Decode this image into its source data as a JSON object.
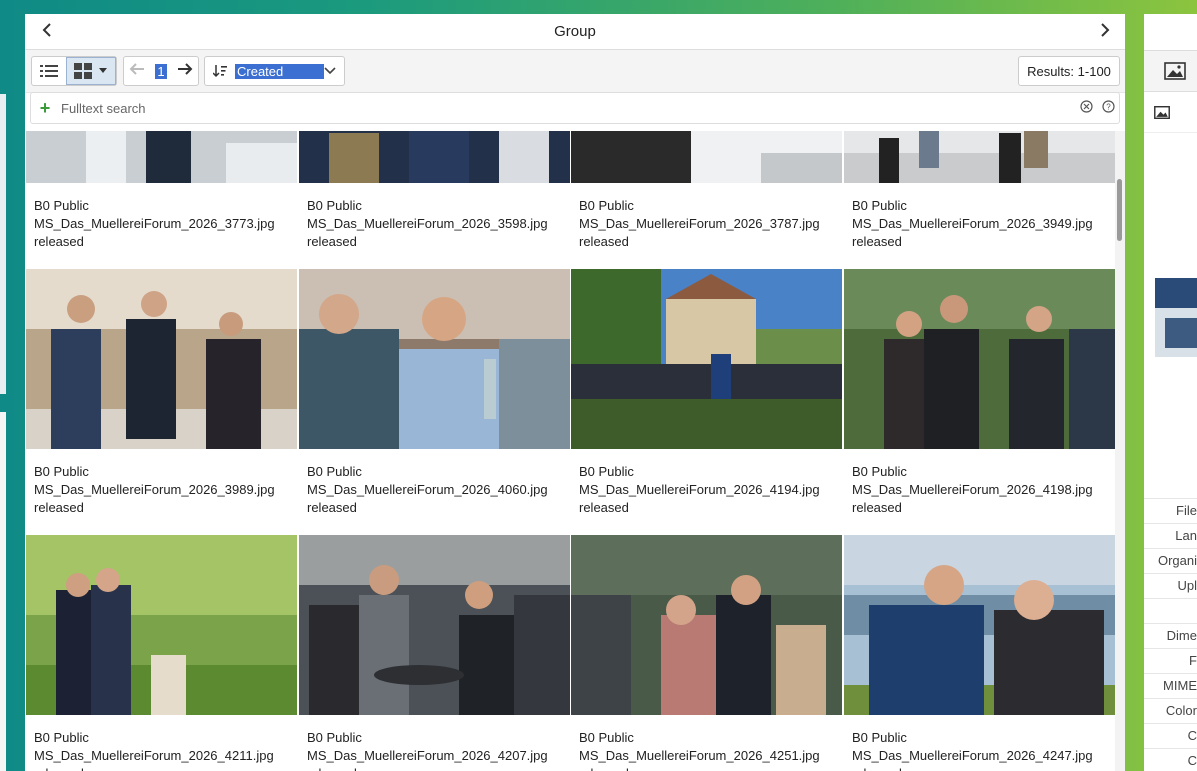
{
  "header": {
    "title": "Group"
  },
  "toolbar": {
    "page": "1",
    "sort_label": "Created",
    "results": "Results: 1-100"
  },
  "search": {
    "placeholder": "Fulltext search"
  },
  "cards": [
    {
      "access": "B0 Public",
      "filename": "MS_Das_MuellereiForum_2026_3773.jpg",
      "status": "released"
    },
    {
      "access": "B0 Public",
      "filename": "MS_Das_MuellereiForum_2026_3598.jpg",
      "status": "released"
    },
    {
      "access": "B0 Public",
      "filename": "MS_Das_MuellereiForum_2026_3787.jpg",
      "status": "released"
    },
    {
      "access": "B0 Public",
      "filename": "MS_Das_MuellereiForum_2026_3949.jpg",
      "status": "released"
    },
    {
      "access": "B0 Public",
      "filename": "MS_Das_MuellereiForum_2026_3989.jpg",
      "status": "released"
    },
    {
      "access": "B0 Public",
      "filename": "MS_Das_MuellereiForum_2026_4060.jpg",
      "status": "released"
    },
    {
      "access": "B0 Public",
      "filename": "MS_Das_MuellereiForum_2026_4194.jpg",
      "status": "released"
    },
    {
      "access": "B0 Public",
      "filename": "MS_Das_MuellereiForum_2026_4198.jpg",
      "status": "released"
    },
    {
      "access": "B0 Public",
      "filename": "MS_Das_MuellereiForum_2026_4211.jpg",
      "status": "released"
    },
    {
      "access": "B0 Public",
      "filename": "MS_Das_MuellereiForum_2026_4207.jpg",
      "status": "released"
    },
    {
      "access": "B0 Public",
      "filename": "MS_Das_MuellereiForum_2026_4251.jpg",
      "status": "released"
    },
    {
      "access": "B0 Public",
      "filename": "MS_Das_MuellereiForum_2026_4247.jpg",
      "status": "released"
    }
  ],
  "right_panel": {
    "labels": [
      "File",
      "Lan",
      "Organi",
      "Upl",
      "",
      "Dime",
      "F",
      "MIME",
      "Color",
      "C",
      "C"
    ]
  },
  "colors": {
    "accent": "#3b6fd1",
    "add": "#3a9a3a"
  }
}
